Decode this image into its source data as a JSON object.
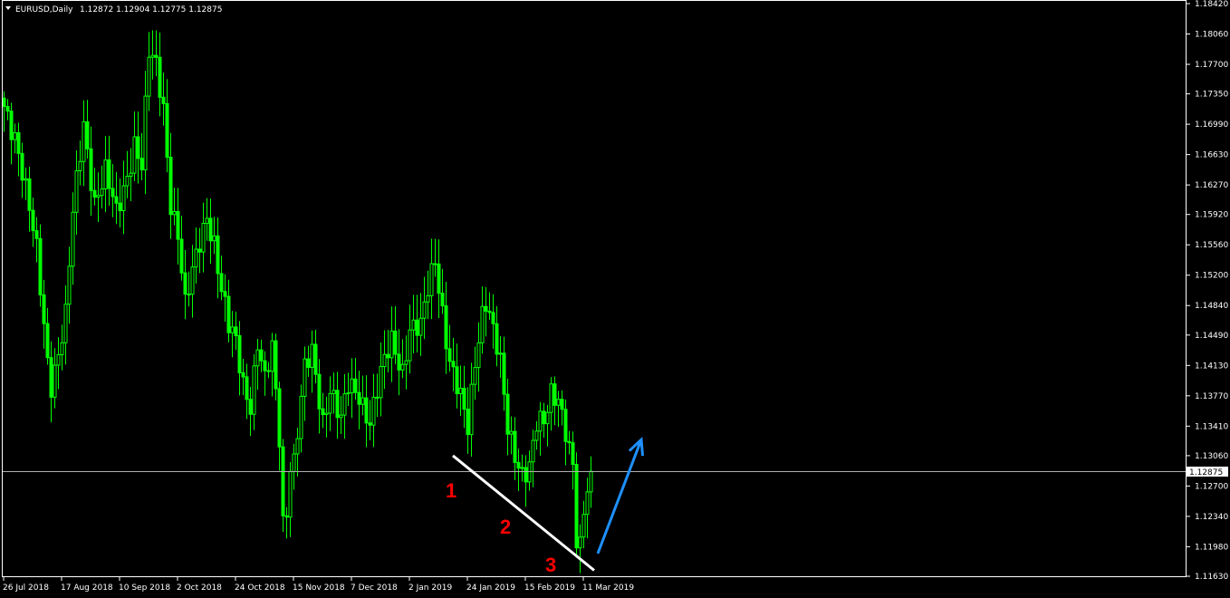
{
  "header": {
    "symbol_timeframe": "EURUSD,Daily",
    "ohlc": "1.12872 1.12904 1.12775 1.12875"
  },
  "colors": {
    "background": "#000000",
    "candle": "#00ff00",
    "axis": "#ffffff",
    "price_line": "#b0b0b0",
    "trendline": "#ffffff",
    "arrow": "#1e90ff",
    "annotation": "#ff0000"
  },
  "chart_data": {
    "type": "candlestick",
    "instrument": "EURUSD",
    "timeframe": "Daily",
    "ylim": [
      1.1163,
      1.1842
    ],
    "current_price": 1.12875,
    "current_price_label": "1.12875",
    "y_ticks": [
      "1.18420",
      "1.18060",
      "1.17700",
      "1.17350",
      "1.16990",
      "1.16630",
      "1.16270",
      "1.15920",
      "1.15560",
      "1.15200",
      "1.14840",
      "1.14490",
      "1.14130",
      "1.13770",
      "1.13410",
      "1.13060",
      "1.12700",
      "1.12340",
      "1.11980",
      "1.11630"
    ],
    "x_ticks": [
      "26 Jul 2018",
      "17 Aug 2018",
      "10 Sep 2018",
      "2 Oct 2018",
      "24 Oct 2018",
      "15 Nov 2018",
      "7 Dec 2018",
      "2 Jan 2019",
      "24 Jan 2019",
      "15 Feb 2019",
      "11 Mar 2019"
    ],
    "x_ticks_index": [
      0,
      16,
      32,
      48,
      64,
      80,
      96,
      112,
      128,
      144,
      160
    ],
    "bar_count": 163,
    "anchors": [
      [
        0,
        1.172
      ],
      [
        3,
        1.169
      ],
      [
        5,
        1.1645
      ],
      [
        9,
        1.1545
      ],
      [
        12,
        1.142
      ],
      [
        13,
        1.1395
      ],
      [
        15,
        1.143
      ],
      [
        17,
        1.147
      ],
      [
        19,
        1.159
      ],
      [
        22,
        1.17
      ],
      [
        25,
        1.161
      ],
      [
        28,
        1.164
      ],
      [
        31,
        1.159
      ],
      [
        34,
        1.164
      ],
      [
        36,
        1.168
      ],
      [
        38,
        1.165
      ],
      [
        40,
        1.178
      ],
      [
        42,
        1.1765
      ],
      [
        44,
        1.172
      ],
      [
        46,
        1.161
      ],
      [
        48,
        1.157
      ],
      [
        50,
        1.148
      ],
      [
        52,
        1.152
      ],
      [
        54,
        1.156
      ],
      [
        56,
        1.1595
      ],
      [
        58,
        1.156
      ],
      [
        60,
        1.15
      ],
      [
        62,
        1.1455
      ],
      [
        64,
        1.144
      ],
      [
        66,
        1.1395
      ],
      [
        68,
        1.137
      ],
      [
        70,
        1.144
      ],
      [
        72,
        1.139
      ],
      [
        74,
        1.143
      ],
      [
        76,
        1.133
      ],
      [
        77,
        1.123
      ],
      [
        78,
        1.1245
      ],
      [
        79,
        1.13
      ],
      [
        80,
        1.13
      ],
      [
        83,
        1.1405
      ],
      [
        85,
        1.1425
      ],
      [
        88,
        1.135
      ],
      [
        90,
        1.139
      ],
      [
        93,
        1.1345
      ],
      [
        95,
        1.1385
      ],
      [
        98,
        1.138
      ],
      [
        101,
        1.135
      ],
      [
        104,
        1.14
      ],
      [
        107,
        1.144
      ],
      [
        110,
        1.141
      ],
      [
        112,
        1.146
      ],
      [
        115,
        1.1455
      ],
      [
        117,
        1.15
      ],
      [
        119,
        1.154
      ],
      [
        121,
        1.148
      ],
      [
        123,
        1.142
      ],
      [
        126,
        1.137
      ],
      [
        128,
        1.1335
      ],
      [
        130,
        1.142
      ],
      [
        132,
        1.148
      ],
      [
        133,
        1.1495
      ],
      [
        135,
        1.1455
      ],
      [
        137,
        1.141
      ],
      [
        139,
        1.1335
      ],
      [
        141,
        1.131
      ],
      [
        143,
        1.129
      ],
      [
        145,
        1.1295
      ],
      [
        147,
        1.134
      ],
      [
        149,
        1.134
      ],
      [
        151,
        1.138
      ],
      [
        153,
        1.138
      ],
      [
        155,
        1.134
      ],
      [
        157,
        1.129
      ],
      [
        158,
        1.12
      ],
      [
        159,
        1.119
      ],
      [
        160,
        1.1235
      ],
      [
        161,
        1.1265
      ],
      [
        162,
        1.12875
      ]
    ],
    "annotations": {
      "labels": [
        "1",
        "2",
        "3"
      ],
      "trendline": {
        "from": [
          124,
          1.1306
        ],
        "to": [
          163,
          1.117
        ]
      },
      "arrow": {
        "from": [
          164,
          1.119
        ],
        "to": [
          176,
          1.1325
        ]
      }
    }
  }
}
